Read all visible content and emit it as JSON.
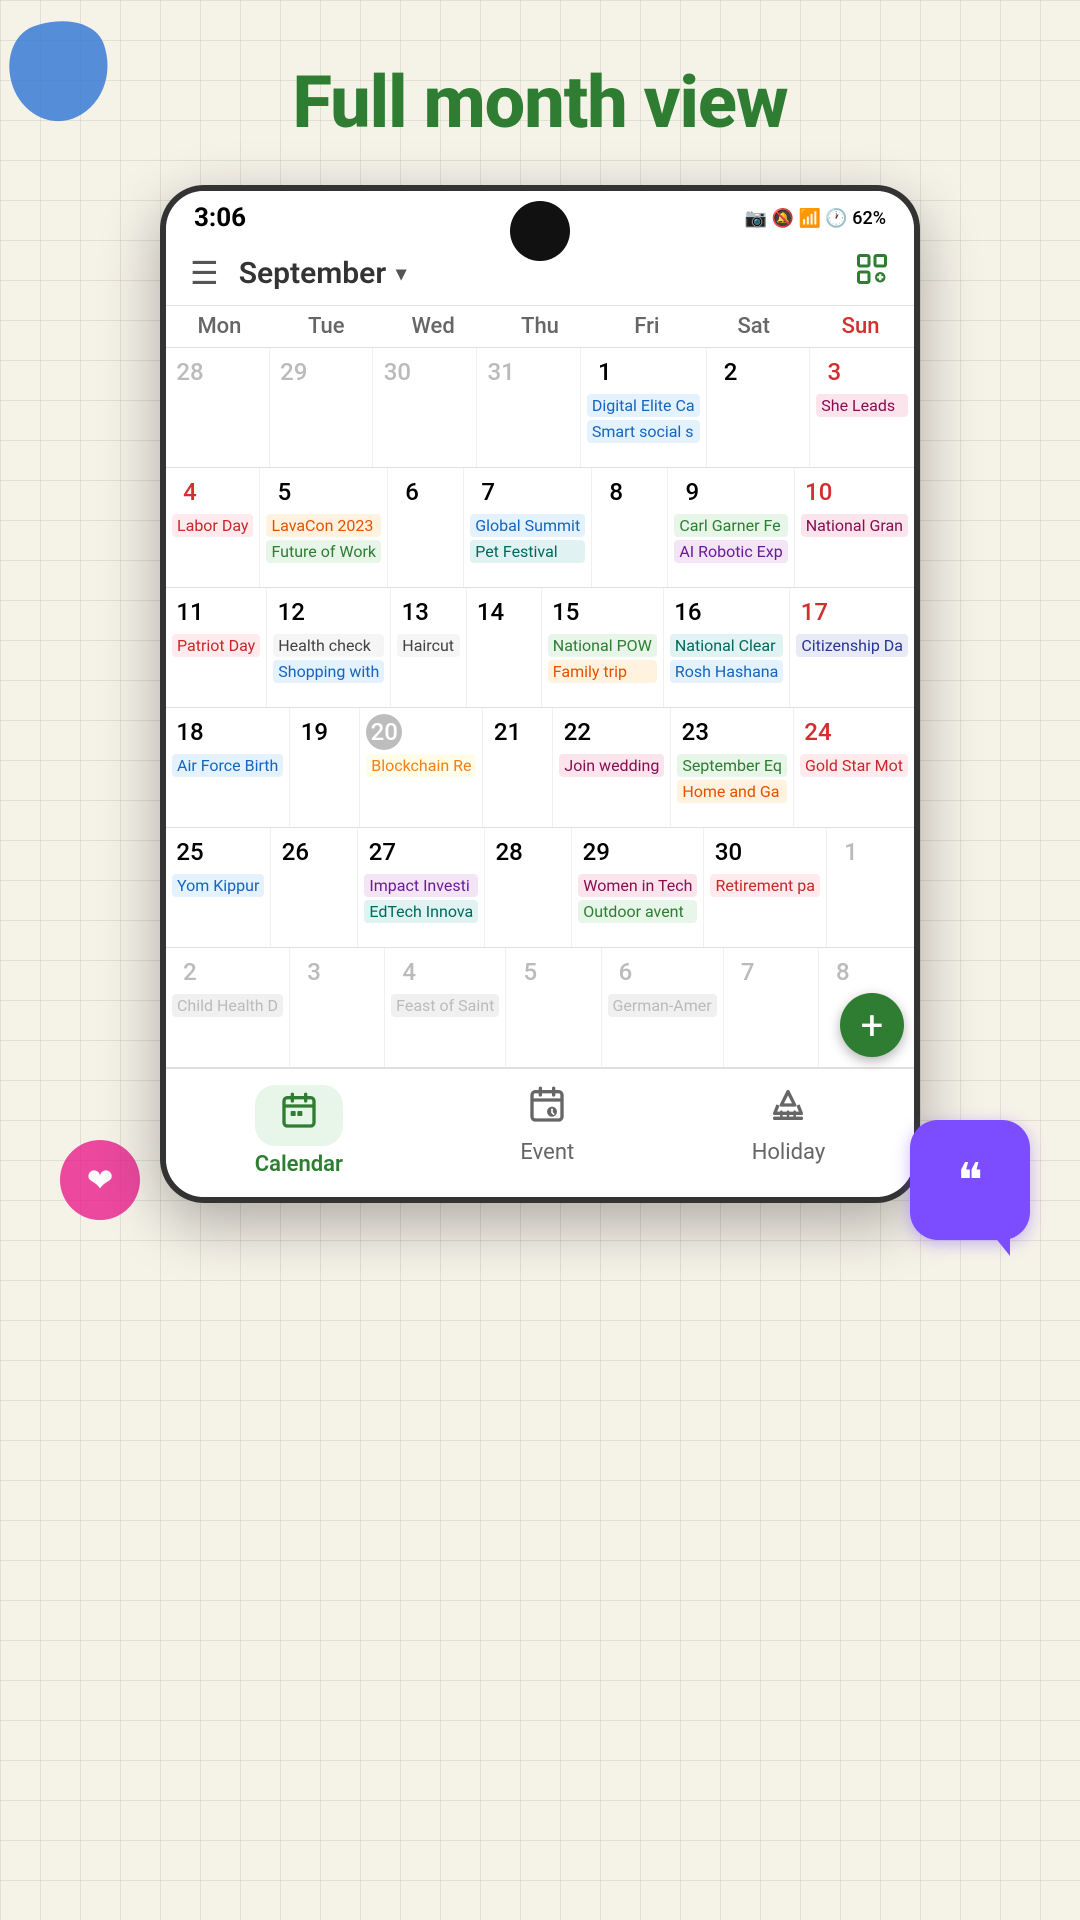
{
  "page": {
    "title": "Full month view",
    "background": "#f5f2e8"
  },
  "status_bar": {
    "time": "3:06",
    "battery": "62%",
    "icons": "📷 🔕 📶 🕐"
  },
  "header": {
    "month": "September",
    "hamburger_label": "☰",
    "dropdown_arrow": "▾",
    "settings_label": "⚙"
  },
  "day_headers": [
    "Mon",
    "Tue",
    "Wed",
    "Thu",
    "Fri",
    "Sat",
    "Sun"
  ],
  "weeks": [
    {
      "days": [
        {
          "date": "28",
          "type": "other-month",
          "events": []
        },
        {
          "date": "29",
          "type": "other-month",
          "events": []
        },
        {
          "date": "30",
          "type": "other-month",
          "events": []
        },
        {
          "date": "31",
          "type": "other-month",
          "events": []
        },
        {
          "date": "1",
          "type": "normal",
          "events": [
            {
              "label": "Digital Elite Ca",
              "style": "blue"
            },
            {
              "label": "Smart social s",
              "style": "blue"
            }
          ]
        },
        {
          "date": "2",
          "type": "normal",
          "events": []
        },
        {
          "date": "3",
          "type": "sunday",
          "events": [
            {
              "label": "She Leads",
              "style": "pink"
            }
          ]
        }
      ]
    },
    {
      "days": [
        {
          "date": "4",
          "type": "red-day",
          "events": [
            {
              "label": "Labor Day",
              "style": "red"
            }
          ]
        },
        {
          "date": "5",
          "type": "normal",
          "events": [
            {
              "label": "LavaCon 2023",
              "style": "orange"
            },
            {
              "label": "Future of Work",
              "style": "green"
            }
          ]
        },
        {
          "date": "6",
          "type": "normal",
          "events": []
        },
        {
          "date": "7",
          "type": "normal",
          "events": [
            {
              "label": "Global Summit",
              "style": "blue"
            },
            {
              "label": "Pet Festival",
              "style": "teal"
            }
          ]
        },
        {
          "date": "8",
          "type": "normal",
          "events": []
        },
        {
          "date": "9",
          "type": "normal",
          "events": [
            {
              "label": "Carl Garner Fe",
              "style": "green"
            },
            {
              "label": "AI Robotic Exp",
              "style": "purple"
            }
          ]
        },
        {
          "date": "10",
          "type": "sunday",
          "events": [
            {
              "label": "National Gran",
              "style": "pink"
            }
          ]
        }
      ]
    },
    {
      "days": [
        {
          "date": "11",
          "type": "normal",
          "events": [
            {
              "label": "Patriot Day",
              "style": "red"
            }
          ]
        },
        {
          "date": "12",
          "type": "normal",
          "events": [
            {
              "label": "Health check",
              "style": "gray"
            },
            {
              "label": "Shopping with",
              "style": "blue"
            }
          ]
        },
        {
          "date": "13",
          "type": "normal",
          "events": [
            {
              "label": "Haircut",
              "style": "gray"
            }
          ]
        },
        {
          "date": "14",
          "type": "normal",
          "events": []
        },
        {
          "date": "15",
          "type": "normal",
          "events": [
            {
              "label": "National POW",
              "style": "green"
            },
            {
              "label": "Family trip",
              "style": "orange"
            }
          ]
        },
        {
          "date": "16",
          "type": "normal",
          "events": [
            {
              "label": "National Clear",
              "style": "teal"
            },
            {
              "label": "Rosh Hashana",
              "style": "blue"
            }
          ]
        },
        {
          "date": "17",
          "type": "sunday",
          "events": [
            {
              "label": "Citizenship Da",
              "style": "indigo"
            }
          ]
        }
      ]
    },
    {
      "days": [
        {
          "date": "18",
          "type": "normal",
          "events": [
            {
              "label": "Air Force Birth",
              "style": "blue"
            }
          ]
        },
        {
          "date": "19",
          "type": "normal",
          "events": []
        },
        {
          "date": "20",
          "type": "today",
          "events": [
            {
              "label": "Blockchain Re",
              "style": "yellow"
            }
          ]
        },
        {
          "date": "21",
          "type": "normal",
          "events": []
        },
        {
          "date": "22",
          "type": "normal",
          "events": [
            {
              "label": "Join wedding",
              "style": "pink"
            }
          ]
        },
        {
          "date": "23",
          "type": "normal",
          "events": [
            {
              "label": "September Eq",
              "style": "green"
            },
            {
              "label": "Home and Ga",
              "style": "orange"
            }
          ]
        },
        {
          "date": "24",
          "type": "sunday",
          "events": [
            {
              "label": "Gold Star Mot",
              "style": "red"
            }
          ]
        }
      ]
    },
    {
      "days": [
        {
          "date": "25",
          "type": "normal",
          "events": [
            {
              "label": "Yom Kippur",
              "style": "blue"
            }
          ]
        },
        {
          "date": "26",
          "type": "normal",
          "events": []
        },
        {
          "date": "27",
          "type": "normal",
          "events": [
            {
              "label": "Impact Investi",
              "style": "purple"
            },
            {
              "label": "EdTech Innova",
              "style": "teal"
            }
          ]
        },
        {
          "date": "28",
          "type": "normal",
          "events": []
        },
        {
          "date": "29",
          "type": "normal",
          "events": [
            {
              "label": "Women in Tech",
              "style": "pink"
            },
            {
              "label": "Outdoor avent",
              "style": "green"
            }
          ]
        },
        {
          "date": "30",
          "type": "normal",
          "events": [
            {
              "label": "Retirement pa",
              "style": "red"
            }
          ]
        },
        {
          "date": "1",
          "type": "other-month",
          "events": []
        }
      ]
    },
    {
      "days": [
        {
          "date": "2",
          "type": "other-month",
          "events": [
            {
              "label": "Child Health D",
              "style": "teal"
            }
          ]
        },
        {
          "date": "3",
          "type": "other-month",
          "events": []
        },
        {
          "date": "4",
          "type": "other-month",
          "events": [
            {
              "label": "Feast of Saint",
              "style": "brown"
            }
          ]
        },
        {
          "date": "5",
          "type": "other-month",
          "events": []
        },
        {
          "date": "6",
          "type": "other-month",
          "events": [
            {
              "label": "German-Amer",
              "style": "orange"
            }
          ]
        },
        {
          "date": "7",
          "type": "other-month",
          "events": []
        },
        {
          "date": "8",
          "type": "other-month",
          "events": []
        }
      ]
    }
  ],
  "bottom_nav": [
    {
      "label": "Calendar",
      "icon": "📅",
      "active": true
    },
    {
      "label": "Event",
      "icon": "📆",
      "active": false
    },
    {
      "label": "Holiday",
      "icon": "🏖",
      "active": false
    }
  ],
  "fab": {
    "label": "+"
  }
}
